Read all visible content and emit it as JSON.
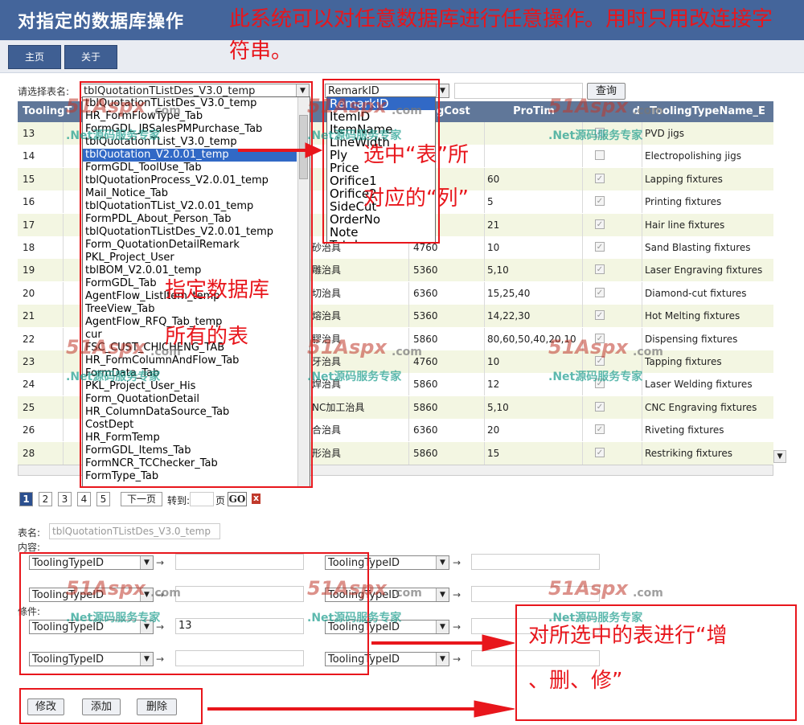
{
  "header": {
    "title": "对指定的数据库操作",
    "note": "此系统可以对任意数据库进行任意操作。用时只用改连接字符串。"
  },
  "nav": {
    "home": "主页",
    "about": "关于"
  },
  "selector": {
    "label": "请选择表名:",
    "table_value": "tblQuotationTListDes_V3.0_temp",
    "column_value": "RemarkID",
    "query_button": "查询"
  },
  "grid": {
    "columns": [
      "ToolingT",
      "ingCost",
      "ProTim",
      "d",
      "ToolingTypeName_E"
    ],
    "rows": [
      {
        "id": "13",
        "cn": "",
        "cost": "",
        "time": "",
        "checked": true,
        "en": "PVD jigs"
      },
      {
        "id": "14",
        "cn": "",
        "cost": "",
        "time": "",
        "checked": false,
        "en": "Electropolishing jigs"
      },
      {
        "id": "15",
        "cn": "",
        "cost": "",
        "time": "60",
        "checked": true,
        "en": "Lapping fixtures"
      },
      {
        "id": "16",
        "cn": "",
        "cost": "",
        "time": "5",
        "checked": true,
        "en": "Printing fixtures"
      },
      {
        "id": "17",
        "cn": "",
        "cost": "",
        "time": "21",
        "checked": true,
        "en": "Hair line fixtures"
      },
      {
        "id": "18",
        "cn": "砂治具",
        "cost": "4760",
        "time": "10",
        "checked": true,
        "en": "Sand Blasting fixtures"
      },
      {
        "id": "19",
        "cn": "雕治具",
        "cost": "5360",
        "time": "5,10",
        "checked": true,
        "en": "Laser Engraving fixtures"
      },
      {
        "id": "20",
        "cn": "切治具",
        "cost": "6360",
        "time": "15,25,40",
        "checked": true,
        "en": "Diamond-cut fixtures"
      },
      {
        "id": "21",
        "cn": "熔治具",
        "cost": "5360",
        "time": "14,22,30",
        "checked": true,
        "en": "Hot Melting fixtures"
      },
      {
        "id": "22",
        "cn": "膠治具",
        "cost": "5860",
        "time": "80,60,50,40,20,10",
        "checked": true,
        "en": "Dispensing fixtures"
      },
      {
        "id": "23",
        "cn": "牙治具",
        "cost": "4760",
        "time": "10",
        "checked": true,
        "en": "Tapping fixtures"
      },
      {
        "id": "24",
        "cn": "焊治具",
        "cost": "5860",
        "time": "12",
        "checked": true,
        "en": "Laser Welding fixtures"
      },
      {
        "id": "25",
        "cn": "NC加工治具",
        "cost": "5860",
        "time": "5,10",
        "checked": true,
        "en": "CNC Engraving fixtures"
      },
      {
        "id": "26",
        "cn": "合治具",
        "cost": "6360",
        "time": "20",
        "checked": true,
        "en": "Riveting fixtures"
      },
      {
        "id": "28",
        "cn": "形治具",
        "cost": "5860",
        "time": "15",
        "checked": true,
        "en": "Restriking fixtures"
      }
    ]
  },
  "table_list": [
    "tblQuotationTListDes_V3.0_temp",
    "HR_FormFlowType_Tab",
    "FormGDL_JBSalesPMPurchase_Tab",
    "tblQuotationTList_V3.0_temp",
    "tblQuotation_V2.0.01_temp",
    "FormGDL_ToolUse_Tab",
    "tblQuotationProcess_V2.0.01_temp",
    "Mail_Notice_Tab",
    "tblQuotationTList_V2.0.01_temp",
    "FormPDL_About_Person_Tab",
    "tblQuotationTListDes_V2.0.01_temp",
    "Form_QuotationDetailRemark",
    "PKL_Project_User",
    "tblBOM_V2.0.01_temp",
    "FormGDL_Tab",
    "AgentFlow_ListItem_temp",
    "TreeView_Tab",
    "AgentFlow_RFQ_Tab_temp",
    "cur",
    "FSC_CUST_CHICHENG_TAB",
    "HR_FormColumnAndFlow_Tab",
    "FormData_Tab",
    "PKL_Project_User_His",
    "Form_QuotationDetail",
    "HR_ColumnDataSource_Tab",
    "CostDept",
    "HR_FormTemp",
    "FormGDL_Items_Tab",
    "FormNCR_TCChecker_Tab",
    "FormType_Tab"
  ],
  "table_list_selected": 4,
  "column_list": [
    "RemarkID",
    "ItemID",
    "ItemName",
    "LineWidth",
    "Ply",
    "Price",
    "Orifice1",
    "Orifice2",
    "SideCut",
    "OrderNo",
    "Note",
    "Total"
  ],
  "column_list_selected": 0,
  "pager": {
    "pages": [
      "1",
      "2",
      "3",
      "4",
      "5"
    ],
    "current": "1",
    "next": "下一页",
    "goto_label": "转到:",
    "page_unit": "页",
    "go_button": "GO",
    "close": "x"
  },
  "form": {
    "table_label": "表名:",
    "table_value": "tblQuotationTListDes_V3.0_temp",
    "content_label": "内容:",
    "condition_label": "條件:",
    "field_default": "ToolingTypeID",
    "arrow": "→",
    "condition_value": "13",
    "btn_modify": "修改",
    "btn_add": "添加",
    "btn_delete": "删除"
  },
  "annotations": {
    "select_columns_1": "选中“表”所",
    "select_columns_2": "对应的“列”",
    "all_tables_1": "指定数据库",
    "all_tables_2": "所有的表",
    "crud_1": "对所选中的表进行“增",
    "crud_2": "、删、修”"
  },
  "watermark": {
    "logo": "51Aspx",
    "com": ".com",
    "sub": ".Net源码服务专家"
  }
}
